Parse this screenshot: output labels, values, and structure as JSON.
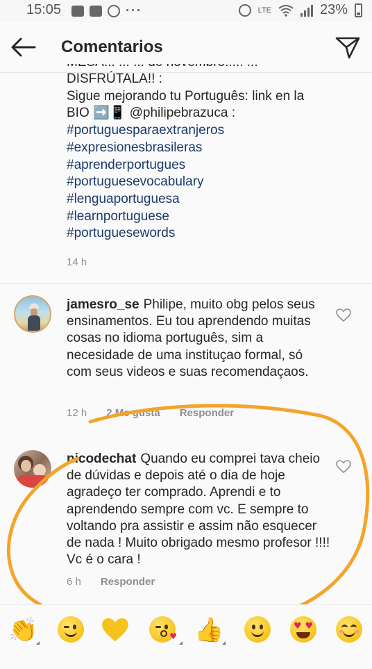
{
  "status_bar": {
    "time": "15:05",
    "dots": "···",
    "network": "LTE",
    "battery_percent": "23%"
  },
  "header": {
    "title": "Comentarios"
  },
  "caption": {
    "cut_line": "MESA... ... ... de novembro!!... ...",
    "line1": "DISFRÚTALA!! :",
    "line2": "Sigue mejorando tu Português: link en la",
    "line3": "BIO ➡️📱 @philipebrazuca :",
    "hashtags": [
      "#portuguesparaextranjeros",
      "#expresionesbrasileras",
      "#aprenderportugues",
      "#portuguesevocabulary",
      "#lenguaportuguesa",
      "#learnportuguese",
      "#portuguesewords"
    ],
    "time": "14 h"
  },
  "comments": [
    {
      "username": "jamesro_se",
      "text": "Philipe, muito obg pelos seus ensinamentos. Eu tou aprendendo muitas cosas no idioma português, sim a necesidade de uma instituçao formal, só com seus videos e suas recomendaçaos.",
      "time": "12 h",
      "likes": "2 Me gusta",
      "reply": "Responder"
    },
    {
      "username": "nicodechat",
      "text": "Quando eu comprei tava cheio de dúvidas e depois até o dia de hoje agradeço ter comprado.  Aprendi e to aprendendo sempre com vc. E sempre to voltando pra assistir e assim não esquecer de nada ! Muito obrigado mesmo profesor !!!! Vc é o cara !",
      "time": "6 h",
      "reply": "Responder"
    }
  ],
  "emoji_bar": {
    "emojis": [
      "clapping-hands",
      "winking-face",
      "yellow-heart",
      "face-blowing-kiss",
      "thumbs-up",
      "slightly-smiling-face",
      "heart-eyes-face",
      "smiling-face-with-smiling-eyes"
    ]
  },
  "colors": {
    "hashtag": "#1b3a6b",
    "annotation": "#f4a42a",
    "meta_gray": "#8e8e8e"
  }
}
